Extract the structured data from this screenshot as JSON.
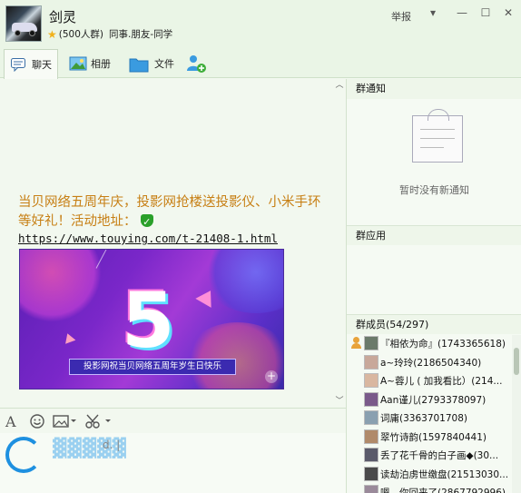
{
  "header": {
    "group_name": "剑灵",
    "group_size": "(500人群)",
    "group_tags": "同事.朋友-同学",
    "report_label": "举报",
    "icons": [
      "star-icon",
      "dropdown-icon",
      "minimize-icon",
      "maximize-icon",
      "close-icon"
    ]
  },
  "tabs": [
    {
      "label": "聊天",
      "icon": "chat-icon",
      "active": true
    },
    {
      "label": "相册",
      "icon": "photo-icon",
      "active": false
    },
    {
      "label": "文件",
      "icon": "folder-icon",
      "active": false
    },
    {
      "label": "",
      "icon": "add-member-icon",
      "active": false
    }
  ],
  "chat": {
    "message_text": "当贝网络五周年庆，投影网抢楼送投影仪、小米手环等好礼！活动地址：",
    "message_link": "https://www.touying.com/t-21408-1.html",
    "promo_banner_text": "投影网祝当贝网络五周年岁生日快乐",
    "promo_number": "5"
  },
  "input_area": {
    "caret_text": "d. |",
    "toolbar_icons": [
      "font-icon",
      "emoji-icon",
      "image-icon",
      "scissors-icon"
    ]
  },
  "right_panel": {
    "notice_title": "群通知",
    "no_notice_text": "暂时没有新通知",
    "apps_title": "群应用",
    "members_title": "群成员(54/297)",
    "members": [
      {
        "name": "『相依为命』(1743365618)",
        "owner": true
      },
      {
        "name": "a~玲玲(2186504340)",
        "owner": false
      },
      {
        "name": "A~蓉儿 ( 加我看比）(214...",
        "owner": false
      },
      {
        "name": "Aan谨儿(2793378097)",
        "owner": false
      },
      {
        "name": "词庸(3363701708)",
        "owner": false
      },
      {
        "name": "翠竹诗韵(1597840441)",
        "owner": false
      },
      {
        "name": "丢了花千骨的白子画◆(30...",
        "owner": false
      },
      {
        "name": "读劫泊虏世缴盘(21513030...",
        "owner": false
      },
      {
        "name": "嗯，你回来了(2867792996)",
        "owner": false
      }
    ]
  },
  "colors": {
    "message_text": "#c77f14",
    "background": "#f2f8ef",
    "accent_blue": "#1e90e0"
  }
}
